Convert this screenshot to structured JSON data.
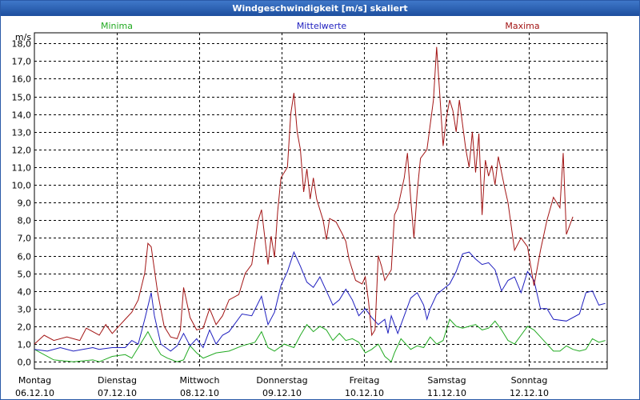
{
  "window": {
    "title": "Windgeschwindigkeit [m/s] skaliert"
  },
  "colors": {
    "min": "#22aa22",
    "mean": "#1f1fbf",
    "max": "#a31515",
    "grid": "#000000"
  },
  "chart_data": {
    "type": "line",
    "title": "Windgeschwindigkeit [m/s] skaliert",
    "ylabel": "m/s",
    "ylim": [
      -0.4,
      18.6
    ],
    "yticks": [
      "0,0",
      "1,0",
      "2,0",
      "3,0",
      "4,0",
      "5,0",
      "6,0",
      "7,0",
      "8,0",
      "9,0",
      "10,0",
      "11,0",
      "12,0",
      "13,0",
      "14,0",
      "15,0",
      "16,0",
      "17,0",
      "18,0"
    ],
    "x_range_days": [
      0,
      7
    ],
    "x_days": [
      "Montag",
      "Dienstag",
      "Mittwoch",
      "Donnerstag",
      "Freitag",
      "Samstag",
      "Sonntag"
    ],
    "x_dates": [
      "06.12.10",
      "07.12.10",
      "08.12.10",
      "09.12.10",
      "10.12.10",
      "11.12.10",
      "12.12.10"
    ],
    "grid": true,
    "series": [
      {
        "name": "Minima",
        "key": "min",
        "points": [
          [
            0.0,
            0.7
          ],
          [
            0.3,
            0.1
          ],
          [
            0.6,
            0.0
          ],
          [
            0.9,
            0.1
          ],
          [
            1.0,
            0.0
          ],
          [
            1.2,
            0.3
          ],
          [
            1.4,
            0.4
          ],
          [
            1.5,
            0.2
          ],
          [
            1.6,
            0.8
          ],
          [
            1.75,
            1.7
          ],
          [
            1.85,
            1.0
          ],
          [
            1.95,
            0.4
          ],
          [
            2.05,
            0.2
          ],
          [
            2.2,
            0.0
          ],
          [
            2.3,
            0.1
          ],
          [
            2.4,
            0.9
          ],
          [
            2.5,
            0.5
          ],
          [
            2.6,
            0.2
          ],
          [
            2.8,
            0.5
          ],
          [
            3.0,
            0.6
          ],
          [
            3.2,
            0.9
          ],
          [
            3.4,
            1.1
          ],
          [
            3.5,
            1.7
          ],
          [
            3.6,
            0.8
          ],
          [
            3.7,
            0.6
          ],
          [
            3.85,
            1.0
          ],
          [
            4.0,
            0.8
          ],
          [
            4.1,
            1.5
          ],
          [
            4.2,
            2.1
          ],
          [
            4.3,
            1.7
          ],
          [
            4.4,
            2.0
          ],
          [
            4.5,
            1.8
          ],
          [
            4.6,
            1.2
          ],
          [
            4.7,
            1.6
          ],
          [
            4.8,
            1.2
          ],
          [
            4.9,
            1.3
          ],
          [
            5.0,
            1.1
          ],
          [
            5.1,
            0.5
          ],
          [
            5.2,
            0.7
          ],
          [
            5.3,
            1.0
          ],
          [
            5.4,
            0.3
          ],
          [
            5.5,
            0.0
          ],
          [
            5.55,
            0.5
          ],
          [
            5.65,
            1.3
          ],
          [
            5.8,
            0.7
          ],
          [
            5.9,
            0.9
          ],
          [
            6.0,
            0.8
          ],
          [
            6.1,
            1.4
          ],
          [
            6.2,
            1.0
          ],
          [
            6.3,
            1.2
          ],
          [
            6.4,
            2.4
          ],
          [
            6.5,
            2.0
          ],
          [
            6.6,
            1.9
          ],
          [
            6.7,
            2.0
          ],
          [
            6.8,
            2.1
          ],
          [
            6.9,
            1.8
          ],
          [
            7.0,
            1.9
          ],
          [
            7.1,
            2.3
          ],
          [
            7.2,
            1.8
          ],
          [
            7.3,
            1.2
          ],
          [
            7.4,
            1.0
          ],
          [
            7.5,
            1.5
          ],
          [
            7.6,
            2.0
          ],
          [
            7.7,
            1.8
          ],
          [
            7.8,
            1.4
          ],
          [
            7.9,
            1.0
          ],
          [
            8.0,
            0.6
          ],
          [
            8.1,
            0.6
          ],
          [
            8.2,
            0.9
          ],
          [
            8.3,
            0.7
          ],
          [
            8.4,
            0.6
          ],
          [
            8.5,
            0.7
          ],
          [
            8.6,
            1.3
          ],
          [
            8.7,
            1.1
          ],
          [
            8.8,
            1.2
          ]
        ]
      },
      {
        "name": "Mittelwerte",
        "key": "mean",
        "points": [
          [
            0.0,
            0.7
          ],
          [
            0.2,
            0.6
          ],
          [
            0.4,
            0.8
          ],
          [
            0.6,
            0.6
          ],
          [
            0.9,
            0.8
          ],
          [
            1.0,
            0.7
          ],
          [
            1.2,
            0.8
          ],
          [
            1.4,
            0.8
          ],
          [
            1.5,
            1.2
          ],
          [
            1.6,
            1.0
          ],
          [
            1.7,
            2.4
          ],
          [
            1.8,
            3.9
          ],
          [
            1.85,
            2.6
          ],
          [
            1.95,
            1.0
          ],
          [
            2.1,
            0.6
          ],
          [
            2.2,
            0.9
          ],
          [
            2.3,
            1.6
          ],
          [
            2.4,
            0.9
          ],
          [
            2.5,
            1.3
          ],
          [
            2.6,
            0.8
          ],
          [
            2.7,
            1.8
          ],
          [
            2.8,
            1.0
          ],
          [
            2.9,
            1.5
          ],
          [
            3.0,
            1.7
          ],
          [
            3.2,
            2.7
          ],
          [
            3.35,
            2.6
          ],
          [
            3.5,
            3.7
          ],
          [
            3.6,
            2.1
          ],
          [
            3.7,
            2.8
          ],
          [
            3.8,
            4.3
          ],
          [
            3.9,
            5.1
          ],
          [
            4.0,
            6.2
          ],
          [
            4.1,
            5.4
          ],
          [
            4.2,
            4.5
          ],
          [
            4.3,
            4.2
          ],
          [
            4.4,
            4.8
          ],
          [
            4.5,
            4.0
          ],
          [
            4.6,
            3.2
          ],
          [
            4.7,
            3.5
          ],
          [
            4.8,
            4.1
          ],
          [
            4.9,
            3.5
          ],
          [
            5.0,
            2.6
          ],
          [
            5.1,
            3.0
          ],
          [
            5.2,
            2.5
          ],
          [
            5.3,
            2.1
          ],
          [
            5.4,
            2.4
          ],
          [
            5.45,
            1.6
          ],
          [
            5.5,
            2.6
          ],
          [
            5.6,
            1.6
          ],
          [
            5.7,
            2.6
          ],
          [
            5.8,
            3.6
          ],
          [
            5.9,
            3.9
          ],
          [
            6.0,
            3.2
          ],
          [
            6.05,
            2.4
          ],
          [
            6.1,
            3.0
          ],
          [
            6.2,
            3.8
          ],
          [
            6.3,
            4.1
          ],
          [
            6.4,
            4.4
          ],
          [
            6.5,
            5.1
          ],
          [
            6.6,
            6.1
          ],
          [
            6.7,
            6.2
          ],
          [
            6.8,
            5.8
          ],
          [
            6.9,
            5.5
          ],
          [
            7.0,
            5.6
          ],
          [
            7.1,
            5.2
          ],
          [
            7.2,
            4.0
          ],
          [
            7.3,
            4.6
          ],
          [
            7.4,
            4.8
          ],
          [
            7.5,
            3.9
          ],
          [
            7.6,
            5.1
          ],
          [
            7.7,
            4.6
          ],
          [
            7.8,
            3.0
          ],
          [
            7.9,
            3.0
          ],
          [
            8.0,
            2.4
          ],
          [
            8.2,
            2.3
          ],
          [
            8.4,
            2.7
          ],
          [
            8.5,
            3.9
          ],
          [
            8.6,
            4.0
          ],
          [
            8.7,
            3.2
          ],
          [
            8.8,
            3.3
          ]
        ]
      },
      {
        "name": "Maxima",
        "key": "max",
        "points": [
          [
            0.0,
            1.0
          ],
          [
            0.15,
            1.5
          ],
          [
            0.3,
            1.2
          ],
          [
            0.5,
            1.4
          ],
          [
            0.7,
            1.2
          ],
          [
            0.8,
            1.9
          ],
          [
            1.0,
            1.5
          ],
          [
            1.1,
            2.1
          ],
          [
            1.2,
            1.6
          ],
          [
            1.3,
            2.0
          ],
          [
            1.4,
            2.4
          ],
          [
            1.5,
            2.8
          ],
          [
            1.6,
            3.5
          ],
          [
            1.7,
            5.0
          ],
          [
            1.75,
            6.7
          ],
          [
            1.8,
            6.5
          ],
          [
            1.9,
            3.9
          ],
          [
            2.0,
            2.0
          ],
          [
            2.1,
            1.4
          ],
          [
            2.2,
            1.3
          ],
          [
            2.25,
            1.8
          ],
          [
            2.3,
            4.2
          ],
          [
            2.4,
            2.5
          ],
          [
            2.5,
            1.8
          ],
          [
            2.6,
            1.9
          ],
          [
            2.7,
            3.0
          ],
          [
            2.8,
            2.1
          ],
          [
            2.9,
            2.6
          ],
          [
            3.0,
            3.5
          ],
          [
            3.15,
            3.8
          ],
          [
            3.25,
            5.0
          ],
          [
            3.35,
            5.5
          ],
          [
            3.45,
            8.0
          ],
          [
            3.5,
            8.6
          ],
          [
            3.6,
            5.5
          ],
          [
            3.65,
            7.1
          ],
          [
            3.7,
            5.9
          ],
          [
            3.75,
            8.5
          ],
          [
            3.8,
            10.4
          ],
          [
            3.9,
            11.0
          ],
          [
            3.95,
            14.0
          ],
          [
            4.0,
            15.2
          ],
          [
            4.05,
            13.0
          ],
          [
            4.1,
            12.0
          ],
          [
            4.15,
            9.6
          ],
          [
            4.2,
            10.9
          ],
          [
            4.25,
            9.2
          ],
          [
            4.3,
            10.4
          ],
          [
            4.35,
            9.2
          ],
          [
            4.45,
            8.0
          ],
          [
            4.5,
            6.9
          ],
          [
            4.55,
            8.1
          ],
          [
            4.65,
            7.9
          ],
          [
            4.75,
            7.2
          ],
          [
            4.8,
            6.8
          ],
          [
            4.85,
            5.8
          ],
          [
            4.95,
            4.6
          ],
          [
            5.05,
            4.4
          ],
          [
            5.1,
            4.8
          ],
          [
            5.15,
            3.4
          ],
          [
            5.2,
            1.5
          ],
          [
            5.25,
            1.8
          ],
          [
            5.3,
            6.0
          ],
          [
            5.35,
            5.4
          ],
          [
            5.4,
            4.6
          ],
          [
            5.5,
            5.2
          ],
          [
            5.55,
            8.3
          ],
          [
            5.6,
            8.7
          ],
          [
            5.7,
            10.4
          ],
          [
            5.75,
            11.8
          ],
          [
            5.8,
            9.2
          ],
          [
            5.85,
            7.0
          ],
          [
            5.9,
            9.6
          ],
          [
            5.95,
            11.5
          ],
          [
            6.05,
            12.0
          ],
          [
            6.15,
            14.8
          ],
          [
            6.2,
            17.8
          ],
          [
            6.25,
            15.0
          ],
          [
            6.3,
            12.2
          ],
          [
            6.35,
            13.8
          ],
          [
            6.4,
            14.8
          ],
          [
            6.45,
            14.2
          ],
          [
            6.5,
            13.0
          ],
          [
            6.55,
            14.8
          ],
          [
            6.65,
            12.0
          ],
          [
            6.7,
            11.0
          ],
          [
            6.75,
            13.0
          ],
          [
            6.8,
            10.7
          ],
          [
            6.85,
            12.9
          ],
          [
            6.9,
            8.3
          ],
          [
            6.95,
            11.4
          ],
          [
            7.0,
            10.5
          ],
          [
            7.05,
            11.1
          ],
          [
            7.1,
            10.0
          ],
          [
            7.15,
            11.6
          ],
          [
            7.25,
            9.8
          ],
          [
            7.3,
            9.0
          ],
          [
            7.4,
            6.3
          ],
          [
            7.5,
            7.0
          ],
          [
            7.6,
            6.5
          ],
          [
            7.7,
            4.3
          ],
          [
            7.8,
            6.3
          ],
          [
            7.9,
            8.0
          ],
          [
            8.0,
            9.3
          ],
          [
            8.1,
            8.7
          ],
          [
            8.15,
            11.8
          ],
          [
            8.2,
            7.2
          ],
          [
            8.3,
            8.2
          ]
        ]
      }
    ]
  }
}
